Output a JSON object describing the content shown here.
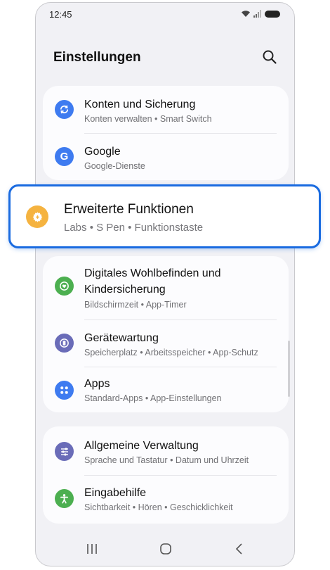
{
  "status_bar": {
    "time": "12:45"
  },
  "header": {
    "title": "Einstellungen"
  },
  "cards": [
    {
      "items": [
        {
          "title": "Konten und Sicherung",
          "subtitle": "Konten verwalten  •  Smart Switch",
          "icon": "sync-icon",
          "color": "#3e7bf0"
        },
        {
          "title": "Google",
          "subtitle": "Google-Dienste",
          "icon": "google-icon",
          "color": "#3e7bf0"
        }
      ]
    },
    {
      "items": [
        {
          "title": "Digitales Wohlbefinden und",
          "title2": "Kindersicherung",
          "subtitle": "Bildschirmzeit  •  App-Timer",
          "icon": "wellbeing-icon",
          "color": "#4caf50"
        },
        {
          "title": "Gerätewartung",
          "subtitle": "Speicherplatz  •  Arbeitsspeicher  •  App-Schutz",
          "icon": "device-care-icon",
          "color": "#6a6cb8"
        },
        {
          "title": "Apps",
          "subtitle": "Standard-Apps  •  App-Einstellungen",
          "icon": "apps-icon",
          "color": "#3e7bf0"
        }
      ]
    },
    {
      "items": [
        {
          "title": "Allgemeine Verwaltung",
          "subtitle": "Sprache und Tastatur  •  Datum und Uhrzeit",
          "icon": "sliders-icon",
          "color": "#6a6cb8"
        },
        {
          "title": "Eingabehilfe",
          "subtitle": "Sichtbarkeit  •  Hören  •  Geschicklichkeit",
          "icon": "accessibility-icon",
          "color": "#4caf50"
        }
      ]
    }
  ],
  "highlight": {
    "title": "Erweiterte Funktionen",
    "subtitle": "Labs  •  S Pen  •  Funktionstaste",
    "icon": "gear-plus-icon",
    "color": "#f5b340",
    "border_color": "#1a6be0"
  }
}
